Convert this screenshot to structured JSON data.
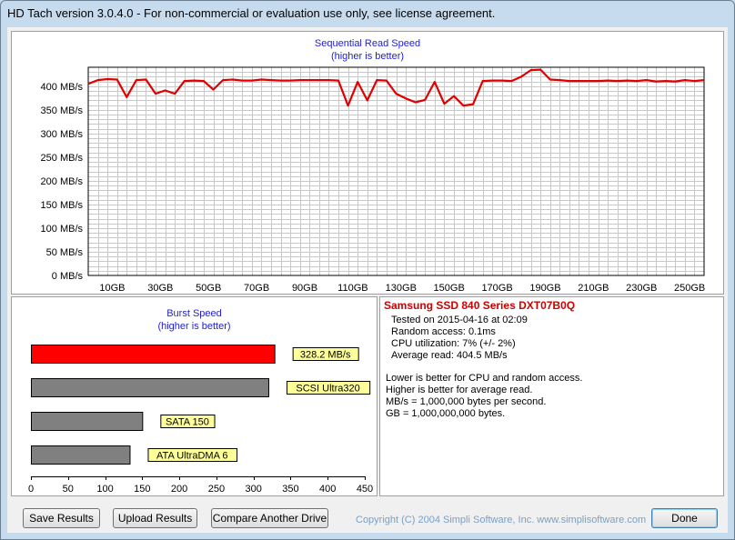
{
  "window": {
    "title": "HD Tach version 3.0.4.0  - For non-commercial or evaluation use only, see license agreement."
  },
  "sequential": {
    "title": "Sequential Read Speed",
    "subtitle": "(higher is better)",
    "color": "#e00000",
    "chart_data": {
      "type": "line",
      "title": "Sequential Read Speed",
      "subtitle": "(higher is better)",
      "xlabel": "",
      "ylabel": "",
      "xlim": [
        0,
        256
      ],
      "ylim": [
        0,
        440
      ],
      "y_ticks": [
        0,
        50,
        100,
        150,
        200,
        250,
        300,
        350,
        400
      ],
      "y_tick_labels": [
        "0 MB/s",
        "50 MB/s",
        "100 MB/s",
        "150 MB/s",
        "200 MB/s",
        "250 MB/s",
        "300 MB/s",
        "350 MB/s",
        "400 MB/s"
      ],
      "x_ticks": [
        10,
        30,
        50,
        70,
        90,
        110,
        130,
        150,
        170,
        190,
        210,
        230,
        250
      ],
      "x_tick_labels": [
        "10GB",
        "30GB",
        "50GB",
        "70GB",
        "90GB",
        "110GB",
        "130GB",
        "150GB",
        "170GB",
        "190GB",
        "210GB",
        "230GB",
        "250GB"
      ],
      "grid": true,
      "series": [
        {
          "x": [
            0,
            4,
            8,
            12,
            16,
            20,
            24,
            28,
            32,
            36,
            40,
            44,
            48,
            52,
            56,
            60,
            64,
            68,
            72,
            76,
            80,
            84,
            88,
            92,
            96,
            100,
            104,
            108,
            112,
            116,
            120,
            124,
            128,
            132,
            136,
            140,
            144,
            148,
            152,
            156,
            160,
            164,
            168,
            172,
            176,
            180,
            184,
            188,
            192,
            196,
            200,
            204,
            208,
            212,
            216,
            220,
            224,
            228,
            232,
            236,
            240,
            244,
            248,
            252,
            256
          ],
          "y": [
            405,
            413,
            415,
            414,
            377,
            413,
            414,
            384,
            391,
            384,
            411,
            412,
            411,
            393,
            413,
            414,
            412,
            412,
            414,
            413,
            412,
            412,
            413,
            413,
            413,
            413,
            412,
            359,
            409,
            370,
            413,
            412,
            384,
            374,
            366,
            371,
            409,
            363,
            379,
            359,
            362,
            411,
            412,
            412,
            411,
            420,
            434,
            435,
            414,
            413,
            411,
            411,
            411,
            411,
            412,
            411,
            412,
            411,
            413,
            410,
            411,
            410,
            413,
            411,
            413
          ]
        }
      ]
    }
  },
  "burst": {
    "title": "Burst Speed",
    "subtitle": "(higher is better)",
    "chart_data": {
      "type": "bar",
      "title": "Burst Speed",
      "subtitle": "(higher is better)",
      "orientation": "horizontal",
      "xlabel": "",
      "ylabel": "",
      "xlim": [
        0,
        450
      ],
      "x_ticks": [
        0,
        50,
        100,
        150,
        200,
        250,
        300,
        350,
        400,
        450
      ],
      "categories": [
        "Samsung SSD 840 Series",
        "SCSI Ultra320",
        "SATA 150",
        "ATA UltraDMA 6"
      ],
      "values": [
        328.2,
        320,
        150,
        133
      ],
      "labels": [
        "328.2 MB/s",
        "SCSI Ultra320",
        "SATA 150",
        "ATA UltraDMA 6"
      ],
      "colors": [
        "#ff0000",
        "#808080",
        "#808080",
        "#808080"
      ],
      "label_bg": "#ffff99"
    }
  },
  "info": {
    "drive": "Samsung SSD 840 Series DXT07B0Q",
    "tested": "Tested on 2015-04-16 at 02:09",
    "random_access": "Random access: 0.1ms",
    "cpu": "CPU utilization: 7% (+/- 2%)",
    "average": "Average read: 404.5 MB/s",
    "note1": "Lower is better for CPU and random access.",
    "note2": "Higher is better for average read.",
    "note3": "MB/s = 1,000,000 bytes per second.",
    "note4": "GB = 1,000,000,000 bytes."
  },
  "buttons": {
    "save": "Save Results",
    "upload": "Upload Results",
    "compare": "Compare Another Drive",
    "done": "Done"
  },
  "copyright": "Copyright (C) 2004 Simpli Software, Inc. www.simplisoftware.com"
}
